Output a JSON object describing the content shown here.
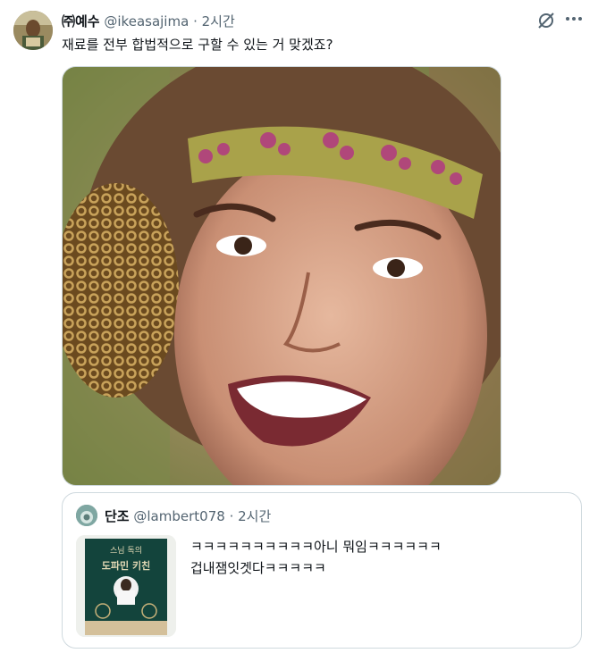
{
  "tweet": {
    "author_name": "㈜예수",
    "author_handle": "@ikeasajima",
    "separator": "·",
    "time": "2시간",
    "text": "재료를 전부 합법적으로 구할 수 있는 거 맞겠죠?",
    "avatar_icon": "user-avatar",
    "grok_icon": "grok-icon",
    "more_icon": "more-icon"
  },
  "media": {
    "description_icon": "photo-smiling-woman-headband"
  },
  "quote": {
    "author_name": "단조",
    "author_handle": "@lambert078",
    "separator": "·",
    "time": "2시간",
    "line1": "ㅋㅋㅋㅋㅋㅋㅋㅋㅋㅋ아니 뭐임ㅋㅋㅋㅋㅋㅋ",
    "line2": "겁내잼잇겟다ㅋㅋㅋㅋㅋ",
    "book_title_text": "스님 독의 도파민 키친"
  },
  "colors": {
    "text": "#0f1419",
    "muted": "#536471",
    "border": "#cfd9de"
  }
}
